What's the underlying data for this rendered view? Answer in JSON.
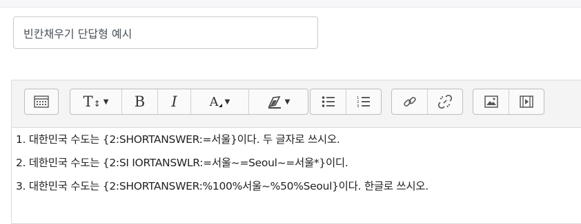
{
  "question_name": {
    "value": "빈칸채우기 단답형 예시"
  },
  "toolbar": {
    "groups": [
      [
        "show-more-buttons-icon"
      ],
      [
        "paragraph-style-icon",
        "bold-icon",
        "italic-icon",
        "text-color-icon",
        "background-color-icon"
      ],
      [
        "unordered-list-icon",
        "ordered-list-icon"
      ],
      [
        "link-icon",
        "unlink-icon"
      ],
      [
        "image-icon",
        "media-icon"
      ]
    ],
    "labels": {
      "heading": "T",
      "bold": "B",
      "italic": "I",
      "font_color": "A"
    }
  },
  "content": {
    "lines": [
      "1. 대한민국 수도는 {2:SHORTANSWER:=서울}이다. 두 글자로 쓰시오.",
      "2. 데한민국 수도는 {2:SI IORTANSWLR:=서울~=Seoul~=서울*}이디.",
      "3. 대한민국 수도는 {2:SHORTANSWER:%100%서울~%50%Seoul}이다. 한글로 쓰시오."
    ]
  }
}
